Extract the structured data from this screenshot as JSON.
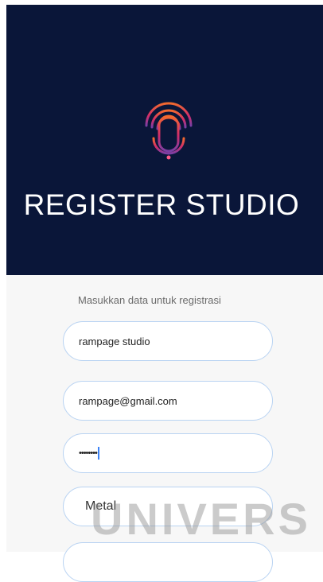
{
  "header": {
    "title": "REGISTER STUDIO",
    "logo_icon": "microphone-broadcast-icon",
    "background": "#0a1639",
    "logo_colors": [
      "#f26a2e",
      "#d12d6a",
      "#7a3fa5"
    ]
  },
  "form": {
    "subtitle": "Masukkan data untuk registrasi",
    "name_value": "rampage studio",
    "email_value": "rampage@gmail.com",
    "password_value": "••••••••",
    "genre_value": "Metal",
    "field_border_color": "#b9d3f2"
  },
  "watermark": {
    "text": "UNIVERS"
  }
}
